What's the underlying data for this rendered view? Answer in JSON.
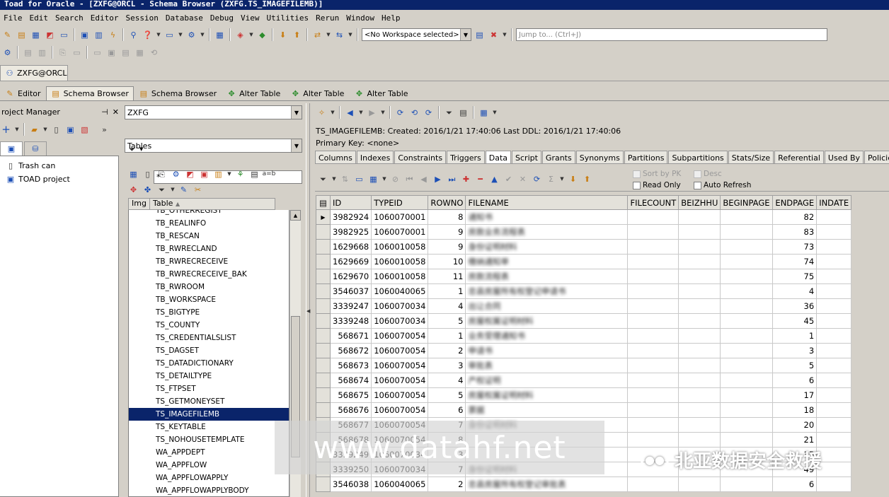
{
  "window": {
    "title": "Toad for Oracle - [ZXFG@ORCL - Schema Browser (ZXFG.TS_IMAGEFILEMB)]"
  },
  "menu": [
    "File",
    "Edit",
    "Search",
    "Editor",
    "Session",
    "Database",
    "Debug",
    "View",
    "Utilities",
    "Rerun",
    "Window",
    "Help"
  ],
  "toolbar": {
    "workspace": "<No Workspace selected>",
    "jump_placeholder": "Jump to... (Ctrl+J)"
  },
  "connection_tab": "ZXFG@ORCL",
  "doc_tabs": [
    "Editor",
    "Schema Browser",
    "Schema Browser",
    "Alter Table",
    "Alter Table",
    "Alter Table"
  ],
  "project_manager": {
    "title": "roject Manager",
    "items": [
      "Trash can",
      "TOAD project"
    ]
  },
  "schema": {
    "owner": "ZXFG",
    "object_type": "Tables",
    "filter": "*",
    "list_headers": [
      "Img",
      "Table"
    ],
    "tables": [
      "TB_OTHERREGIST",
      "TB_REALINFO",
      "TB_RESCAN",
      "TB_RWRECLAND",
      "TB_RWRECRECEIVE",
      "TB_RWRECRECEIVE_BAK",
      "TB_RWROOM",
      "TB_WORKSPACE",
      "TS_BIGTYPE",
      "TS_COUNTY",
      "TS_CREDENTIALSLIST",
      "TS_DAGSET",
      "TS_DATADICTIONARY",
      "TS_DETAILTYPE",
      "TS_FTPSET",
      "TS_GETMONEYSET",
      "TS_IMAGEFILEMB",
      "TS_KEYTABLE",
      "TS_NOHOUSETEMPLATE",
      "WA_APPDEPT",
      "WA_APPFLOW",
      "WA_APPFLOWAPPLY",
      "WA_APPFLOWAPPLYBODY"
    ],
    "selected": "TS_IMAGEFILEMB"
  },
  "detail": {
    "info": "TS_IMAGEFILEMB:  Created: 2016/1/21 17:40:06    Last DDL: 2016/1/21 17:40:06",
    "primary_key": "Primary Key:  <none>",
    "tabs": [
      "Columns",
      "Indexes",
      "Constraints",
      "Triggers",
      "Data",
      "Script",
      "Grants",
      "Synonyms",
      "Partitions",
      "Subpartitions",
      "Stats/Size",
      "Referential",
      "Used By",
      "Policies",
      "Auditing"
    ],
    "active_tab": "Data",
    "options": {
      "sort_by_pk": "Sort by PK",
      "desc": "Desc",
      "read_only": "Read Only",
      "auto_refresh": "Auto Refresh"
    }
  },
  "grid": {
    "columns": [
      "ID",
      "TYPEID",
      "ROWNO",
      "FILENAME",
      "FILECOUNT",
      "BEIZHHU",
      "BEGINPAGE",
      "ENDPAGE",
      "INDATE"
    ],
    "rows": [
      [
        "3982924",
        "1060070001",
        "8",
        "通知书",
        "",
        "",
        "",
        "82",
        ""
      ],
      [
        "3982925",
        "1060070001",
        "9",
        "房款业务流程表",
        "",
        "",
        "",
        "83",
        ""
      ],
      [
        "1629668",
        "1060010058",
        "9",
        "身份证明材料",
        "",
        "",
        "",
        "73",
        ""
      ],
      [
        "1629669",
        "1060010058",
        "10",
        "缴纳通知单",
        "",
        "",
        "",
        "74",
        ""
      ],
      [
        "1629670",
        "1060010058",
        "11",
        "房款流程表",
        "",
        "",
        "",
        "75",
        ""
      ],
      [
        "3546037",
        "1060040065",
        "1",
        "忠县房屋所有权登记申请书",
        "",
        "",
        "",
        "4",
        ""
      ],
      [
        "3339247",
        "1060070034",
        "4",
        "出让合同",
        "",
        "",
        "",
        "36",
        ""
      ],
      [
        "3339248",
        "1060070034",
        "5",
        "房屋权属证明材料",
        "",
        "",
        "",
        "45",
        ""
      ],
      [
        "568671",
        "1060070054",
        "1",
        "业务受理通知书",
        "",
        "",
        "",
        "1",
        ""
      ],
      [
        "568672",
        "1060070054",
        "2",
        "申请书",
        "",
        "",
        "",
        "3",
        ""
      ],
      [
        "568673",
        "1060070054",
        "3",
        "审批表",
        "",
        "",
        "",
        "5",
        ""
      ],
      [
        "568674",
        "1060070054",
        "4",
        "产权证明",
        "",
        "",
        "",
        "6",
        ""
      ],
      [
        "568675",
        "1060070054",
        "5",
        "房屋权属证明材料",
        "",
        "",
        "",
        "17",
        ""
      ],
      [
        "568676",
        "1060070054",
        "6",
        "票据",
        "",
        "",
        "",
        "18",
        ""
      ],
      [
        "568677",
        "1060070054",
        "7",
        "身份证明材料",
        "",
        "",
        "",
        "20",
        ""
      ],
      [
        "568678",
        "1060070054",
        "8",
        "",
        "",
        "",
        "",
        "21",
        ""
      ],
      [
        "3339249",
        "1060070034",
        "3",
        "",
        "",
        "",
        "",
        "35",
        ""
      ],
      [
        "3339250",
        "1060070034",
        "7",
        "身份证明材料",
        "",
        "",
        "",
        "49",
        ""
      ],
      [
        "3546038",
        "1060040065",
        "2",
        "忠县房屋所有权登记审批表",
        "",
        "",
        "",
        "6",
        ""
      ]
    ]
  },
  "watermark": {
    "site": "www.datahf.net",
    "brand": "北亚数据安全救援"
  }
}
